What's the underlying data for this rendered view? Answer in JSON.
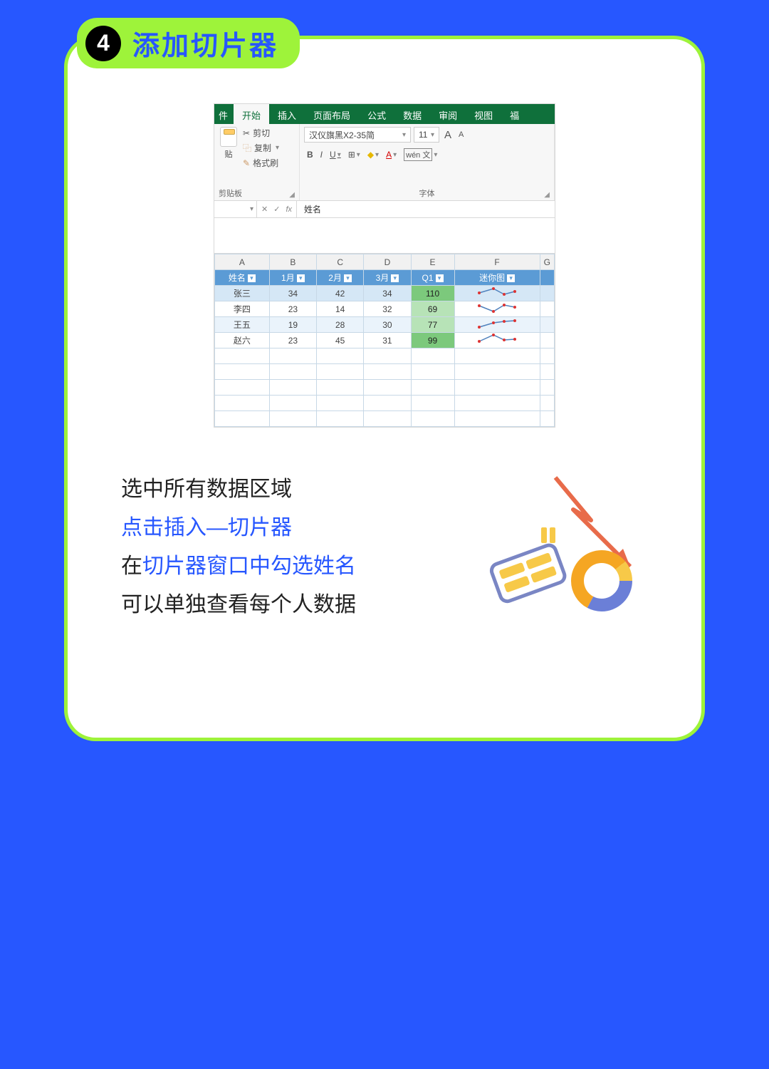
{
  "step": {
    "number": "4",
    "title": "添加切片器"
  },
  "ribbon": {
    "tabs_left_partial": "件",
    "tabs": [
      "开始",
      "插入",
      "页面布局",
      "公式",
      "数据",
      "审阅",
      "视图"
    ],
    "tabs_right_partial": "福",
    "active_tab_index": 0,
    "clipboard": {
      "paste_partial": "贴",
      "cut": "剪切",
      "copy": "复制",
      "format_painter": "格式刷",
      "group_label": "剪贴板"
    },
    "font": {
      "name": "汉仪旗黑X2-35简",
      "size": "11",
      "increase": "A",
      "decrease": "A",
      "group_label": "字体"
    },
    "buttons": {
      "bold": "B",
      "italic": "I",
      "underline": "U",
      "wen": "wén 文"
    }
  },
  "formula_bar": {
    "fx_label": "fx",
    "value": "姓名"
  },
  "sheet": {
    "col_letters": [
      "A",
      "B",
      "C",
      "D",
      "E",
      "F",
      "G"
    ],
    "header": [
      "姓名",
      "1月",
      "2月",
      "3月",
      "Q1",
      "迷你图"
    ],
    "rows": [
      {
        "name": "张三",
        "m1": 34,
        "m2": 42,
        "m3": 34,
        "q1": 110
      },
      {
        "name": "李四",
        "m1": 23,
        "m2": 14,
        "m3": 32,
        "q1": 69
      },
      {
        "name": "王五",
        "m1": 19,
        "m2": 28,
        "m3": 30,
        "q1": 77
      },
      {
        "name": "赵六",
        "m1": 23,
        "m2": 45,
        "m3": 31,
        "q1": 99
      }
    ]
  },
  "instructions": {
    "line1": "选中所有数据区域",
    "line2": "点击插入—切片器",
    "line3_a": "在",
    "line3_b": "切片器窗口中勾选姓名",
    "line4": "可以单独查看每个人数据"
  }
}
